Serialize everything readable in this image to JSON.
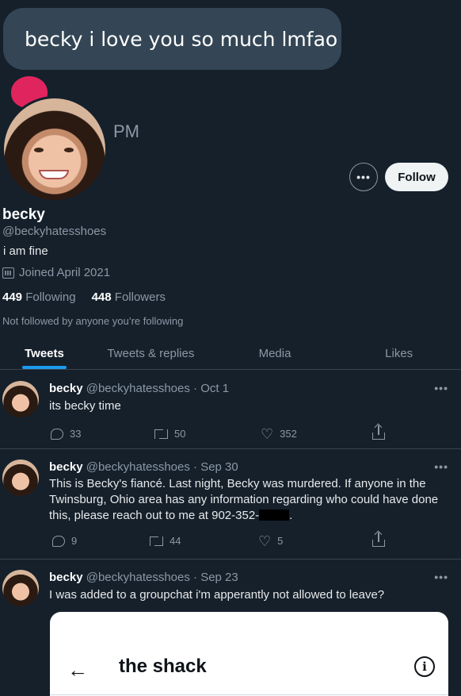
{
  "message_bubble": {
    "text": "becky i love you so much lmfao"
  },
  "partial_time": "PM",
  "profile": {
    "display_name": "becky",
    "handle": "@beckyhatesshoes",
    "bio": "i am fine",
    "joined": "Joined April 2021",
    "following_count": "449",
    "following_label": "Following",
    "followers_count": "448",
    "followers_label": "Followers",
    "not_followed_note": "Not followed by anyone you’re following",
    "more_label": "•••",
    "follow_label": "Follow"
  },
  "tabs": [
    {
      "label": "Tweets",
      "active": true
    },
    {
      "label": "Tweets & replies",
      "active": false
    },
    {
      "label": "Media",
      "active": false
    },
    {
      "label": "Likes",
      "active": false
    }
  ],
  "tweets": [
    {
      "name": "becky",
      "handle": "@beckyhatesshoes",
      "date": "· Oct 1",
      "text": "its becky time",
      "replies": "33",
      "retweets": "50",
      "likes": "352"
    },
    {
      "name": "becky",
      "handle": "@beckyhatesshoes",
      "date": "· Sep 30",
      "text": "This is Becky's fiancé. Last night, Becky was murdered.  If anyone in the Twinsburg, Ohio area has any information regarding who could have done this, please reach out to me at 902-352-",
      "text_end": ".",
      "replies": "9",
      "retweets": "44",
      "likes": "5"
    },
    {
      "name": "becky",
      "handle": "@beckyhatesshoes",
      "date": "· Sep 23",
      "text": "I was added to a groupchat i'm apperantly not allowed to leave?"
    }
  ],
  "card": {
    "back_glyph": "←",
    "title": "the shack",
    "info_glyph": "i"
  },
  "tweet_more": "•••",
  "colors": {
    "background": "#15202b",
    "accent": "#1d9bf0",
    "heart": "#e0245e"
  }
}
